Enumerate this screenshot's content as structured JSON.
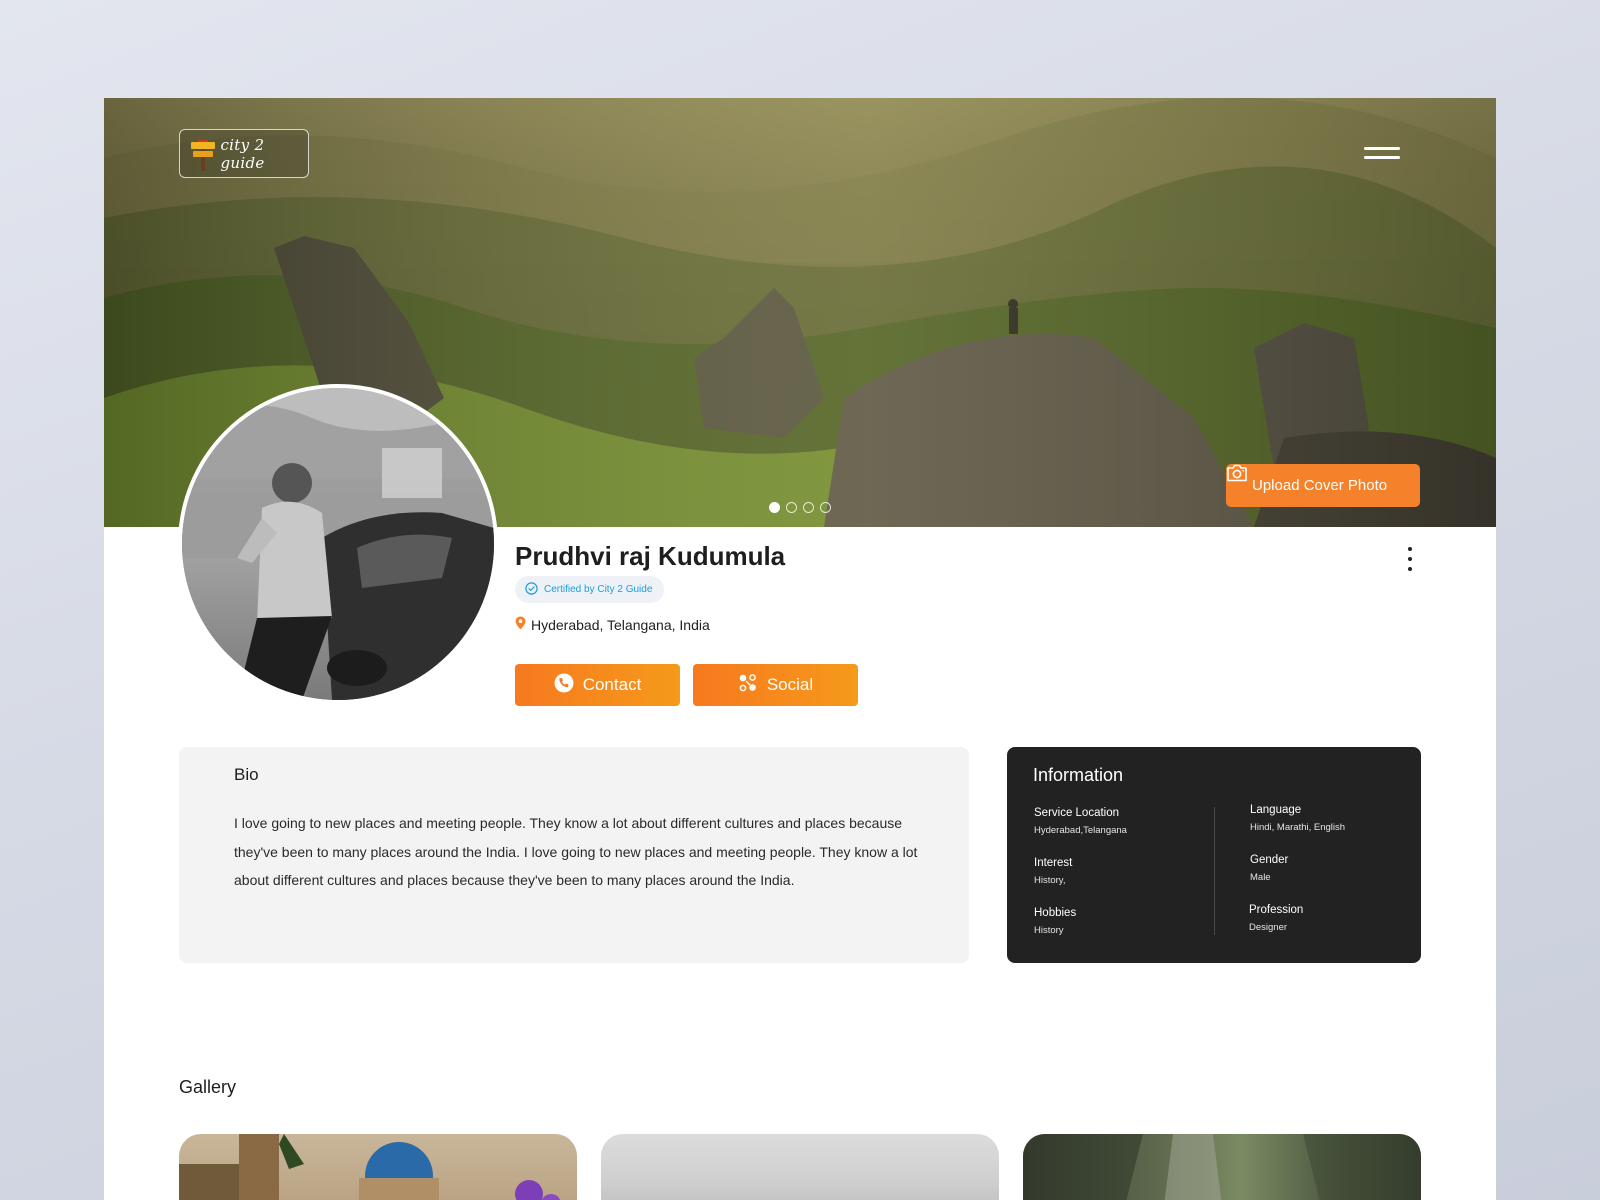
{
  "brand": {
    "logo_text": "city 2 guide",
    "accent": "#F5822A"
  },
  "cover": {
    "upload_label": "Upload Cover Photo",
    "slide_count": 4,
    "active_slide": 1
  },
  "profile": {
    "name": "Prudhvi raj Kudumula",
    "certified": "Certified by City 2 Guide",
    "location": "Hyderabad, Telangana, India",
    "contact_label": "Contact",
    "social_label": "Social"
  },
  "bio": {
    "title": "Bio",
    "text": "I love going to new places and meeting people. They know a lot about different cultures and places because they've been to many places around the India.  I love going to new places and meeting people. They know a lot about different cultures and places because they've been to many places around the India."
  },
  "info": {
    "title": "Information",
    "left": [
      {
        "label": "Service Location",
        "value": "Hyderabad,Telangana"
      },
      {
        "label": "Interest",
        "value": "History,"
      },
      {
        "label": "Hobbies",
        "value": "History"
      }
    ],
    "right": [
      {
        "label": "Language",
        "value": "Hindi, Marathi, English"
      },
      {
        "label": "Gender",
        "value": "Male"
      },
      {
        "label": "Profession",
        "value": "Designer"
      }
    ]
  },
  "gallery": {
    "title": "Gallery"
  },
  "icons": {
    "menu": "hamburger-icon",
    "camera": "camera-icon",
    "verified": "check-circle-icon",
    "location": "map-pin-icon",
    "phone": "phone-icon",
    "social": "social-network-icon",
    "more": "more-vertical-icon"
  }
}
